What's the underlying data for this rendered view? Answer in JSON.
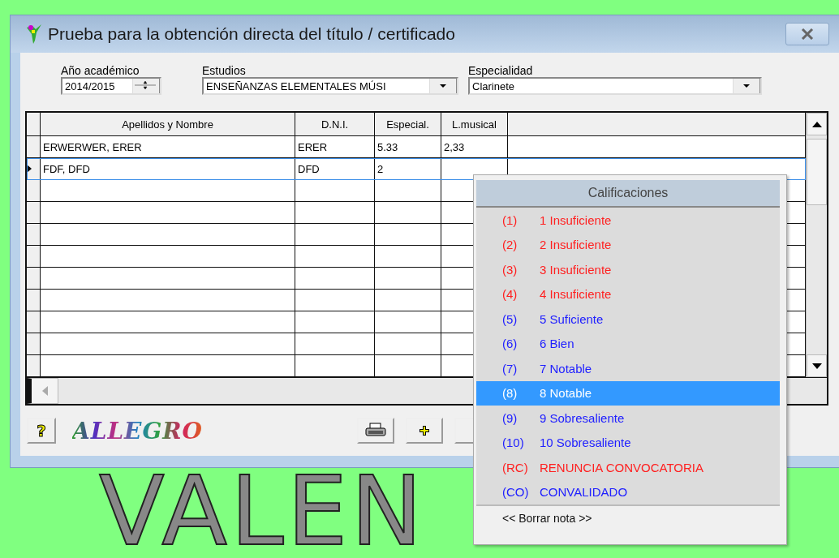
{
  "window": {
    "title": "Prueba para la obtención directa del título / certificado"
  },
  "filters": {
    "year": {
      "label": "Año académico",
      "value": "2014/2015"
    },
    "studies": {
      "label": "Estudios",
      "value": "ENSEÑANZAS ELEMENTALES MÚSI"
    },
    "specialty": {
      "label": "Especialidad",
      "value": "Clarinete"
    }
  },
  "table": {
    "columns": [
      "Apellidos y Nombre",
      "D.N.I.",
      "Especial.",
      "L.musical"
    ],
    "rows": [
      {
        "cells": [
          "ERWERWER, ERER",
          "ERER",
          "5.33",
          "2,33"
        ],
        "selected": false
      },
      {
        "cells": [
          "FDF, DFD",
          "DFD",
          "2",
          ""
        ],
        "selected": true
      }
    ]
  },
  "toolbar": {
    "help": "?",
    "logo": "ALLEGRO"
  },
  "background_text": "VALEN",
  "grades_menu": {
    "title": "Calificaciones",
    "items": [
      {
        "code": "(1)",
        "label": "1 Insuficiente",
        "color": "#ff2020",
        "selected": false
      },
      {
        "code": "(2)",
        "label": "2 Insuficiente",
        "color": "#ff2020",
        "selected": false
      },
      {
        "code": "(3)",
        "label": "3 Insuficiente",
        "color": "#ff2020",
        "selected": false
      },
      {
        "code": "(4)",
        "label": "4 Insuficiente",
        "color": "#ff2020",
        "selected": false
      },
      {
        "code": "(5)",
        "label": "5 Suficiente",
        "color": "#2020ff",
        "selected": false
      },
      {
        "code": "(6)",
        "label": "6 Bien",
        "color": "#2020ff",
        "selected": false
      },
      {
        "code": "(7)",
        "label": "7 Notable",
        "color": "#2020ff",
        "selected": false
      },
      {
        "code": "(8)",
        "label": "8 Notable",
        "selected": true
      },
      {
        "code": "(9)",
        "label": "9 Sobresaliente",
        "color": "#2020ff",
        "selected": false
      },
      {
        "code": "(10)",
        "label": "10 Sobresaliente",
        "color": "#2020ff",
        "selected": false
      },
      {
        "code": "(RC)",
        "label": "RENUNCIA CONVOCATORIA",
        "color": "#ff2020",
        "selected": false
      },
      {
        "code": "(CO)",
        "label": "CONVALIDADO",
        "color": "#2020ff",
        "selected": false
      }
    ],
    "clear": "<< Borrar nota >>"
  }
}
